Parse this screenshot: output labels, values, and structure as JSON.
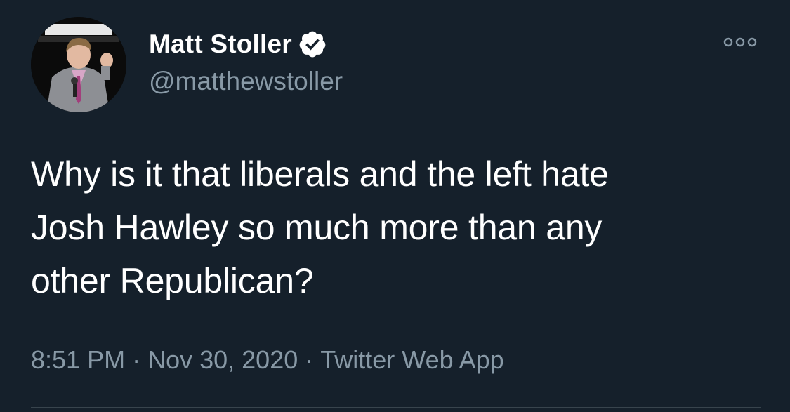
{
  "author": {
    "display_name": "Matt Stoller",
    "handle": "@matthewstoller",
    "verified": true
  },
  "tweet": {
    "lines": [
      "Why is it that liberals and the left hate",
      "Josh Hawley so much more than any",
      "other Republican?"
    ]
  },
  "meta": {
    "time": "8:51 PM",
    "separator": "·",
    "date": "Nov 30, 2020",
    "source": "Twitter Web App"
  },
  "icons": {
    "more": "more-options-icon",
    "verified": "verified-badge-icon"
  },
  "colors": {
    "background": "#15202b",
    "primary_text": "#ffffff",
    "secondary_text": "#8899a6",
    "verified_badge": "#ffffff",
    "divider": "#38444d"
  }
}
